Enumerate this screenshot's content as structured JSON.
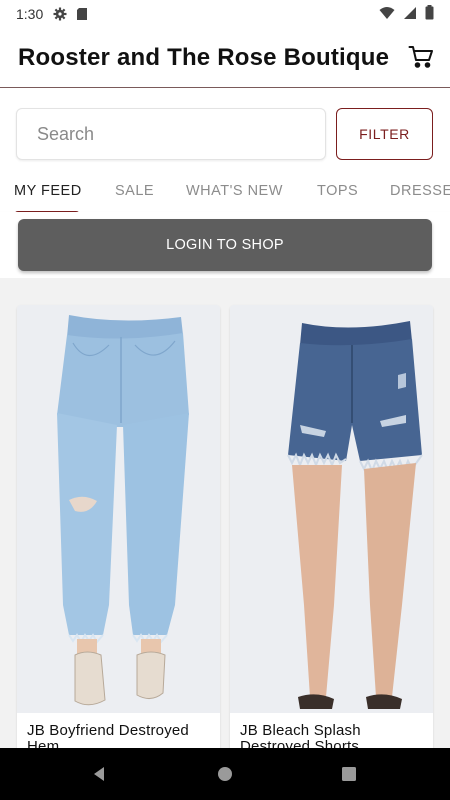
{
  "status_bar": {
    "time": "1:30",
    "left_icons": [
      "gear-icon",
      "sd-card-icon"
    ],
    "right_icons": [
      "wifi-icon",
      "signal-icon",
      "battery-icon"
    ]
  },
  "header": {
    "title": "Rooster and The Rose Boutique",
    "cart_icon": "cart-icon"
  },
  "search": {
    "placeholder": "Search",
    "value": ""
  },
  "filter": {
    "label": "FILTER"
  },
  "tabs": [
    {
      "label": "MY FEED",
      "active": true
    },
    {
      "label": "SALE",
      "active": false
    },
    {
      "label": "WHAT'S NEW",
      "active": false
    },
    {
      "label": "TOPS",
      "active": false
    },
    {
      "label": "DRESSES",
      "active": false
    }
  ],
  "login": {
    "label": "LOGIN TO SHOP"
  },
  "products": [
    {
      "name": "JB Boyfriend Destroyed Hem",
      "image": "light-wash-boyfriend-jeans"
    },
    {
      "name": "JB Bleach Splash Destroyed Shorts",
      "image": "dark-wash-denim-shorts"
    }
  ],
  "nav": {
    "back_icon": "back-icon",
    "home_icon": "home-icon",
    "recents_icon": "recents-icon"
  },
  "colors": {
    "accent": "#7b1e1e",
    "login_bg": "#5e5e5e",
    "feed_bg": "#f2f2f2"
  }
}
